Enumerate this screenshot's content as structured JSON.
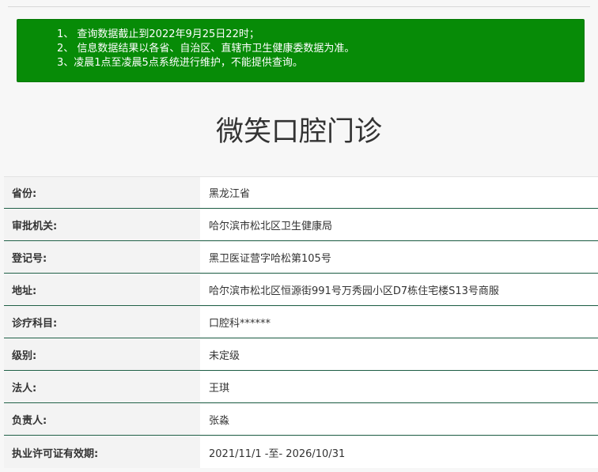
{
  "notice": {
    "lines": [
      "1、 查询数据截止到2022年9月25日22时；",
      "2、 信息数据结果以各省、自治区、直辖市卫生健康委数据为准。",
      "3、凌晨1点至凌晨5点系统进行维护，不能提供查询。"
    ]
  },
  "title": "微笑口腔门诊",
  "rows": [
    {
      "label": "省份:",
      "value": "黑龙江省"
    },
    {
      "label": "审批机关:",
      "value": "哈尔滨市松北区卫生健康局"
    },
    {
      "label": "登记号:",
      "value": "黑卫医证营字哈松第105号"
    },
    {
      "label": "地址:",
      "value": "哈尔滨市松北区恒源街991号万秀园小区D7栋住宅楼S13号商服"
    },
    {
      "label": "诊疗科目:",
      "value": "口腔科******"
    },
    {
      "label": "级别:",
      "value": "未定级"
    },
    {
      "label": "法人:",
      "value": "王琪"
    },
    {
      "label": "负责人:",
      "value": "张淼"
    },
    {
      "label": "执业许可证有效期:",
      "value": "2021/11/1 -至- 2026/10/31"
    }
  ],
  "colors": {
    "notice_bg": "#078b07",
    "row_border": "#1f5f46"
  }
}
